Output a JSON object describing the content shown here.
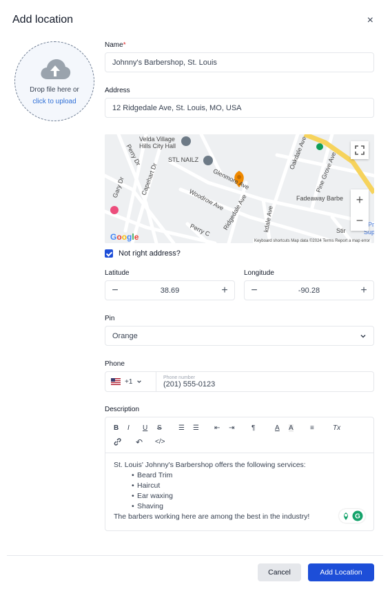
{
  "dialog": {
    "title": "Add location",
    "close": "×"
  },
  "upload": {
    "text": "Drop file here or",
    "link": "click to upload"
  },
  "name": {
    "label": "Name",
    "required_mark": "*",
    "value": "Johnny's Barbershop, St. Louis"
  },
  "address": {
    "label": "Address",
    "value": "12 Ridgedale Ave, St. Louis, MO, USA"
  },
  "map": {
    "labels": {
      "poi1_line1": "Velda Village",
      "poi1_line2": "Hills City Hall",
      "stl_nailz": "STL NAILZ",
      "glenmore": "Glenmore Ave",
      "woodrow": "Woodrow Ave",
      "ridgedale": "Ridgedale Ave",
      "oakdale": "Oakdale Ave",
      "pine_grove": "Pine Grove Ave",
      "fadeaway": "Fadeaway Barbe",
      "capehart": "Capehart Dr",
      "gary": "Gary Dr",
      "perry_dr": "Perry Dr",
      "perry_c": "Perry C",
      "kdale": "kdale Ave",
      "stir": "Stir",
      "pr": "Pr",
      "sup": "Sup"
    },
    "google": "Google",
    "footer": "Keyboard shortcuts   Map data ©2024   Terms   Report a map error",
    "zoom_in": "+",
    "zoom_out": "−"
  },
  "not_right_address": {
    "label": "Not right address?",
    "checked": true
  },
  "latitude": {
    "label": "Latitude",
    "value": "38.69",
    "minus": "−",
    "plus": "+"
  },
  "longitude": {
    "label": "Longitude",
    "value": "-90.28",
    "minus": "−",
    "plus": "+"
  },
  "pin": {
    "label": "Pin",
    "value": "Orange"
  },
  "phone": {
    "label": "Phone",
    "code": "+1",
    "placeholder": "Phone number",
    "value": "(201) 555-0123"
  },
  "description": {
    "label": "Description",
    "toolbar": {
      "bold": "B",
      "italic": "I",
      "underline": "U",
      "strike": "S",
      "ordered": "☰",
      "bullet": "☰",
      "outdent": "⇤",
      "indent": "⇥",
      "paragraph": "¶",
      "font_color": "A",
      "highlight": "A",
      "align": "≡",
      "clear": "Tx",
      "link": "🔗",
      "undo": "↶",
      "code": "</>"
    },
    "intro": "St. Louis' Johnny's Barbershop offers the following services:",
    "services": [
      "Beard Trim",
      "Haircut",
      "Ear waxing",
      "Shaving"
    ],
    "outro": "The barbers working here are among the best in the industry!"
  },
  "buttons": {
    "cancel": "Cancel",
    "add": "Add Location"
  },
  "colors": {
    "primary": "#1d4ed8",
    "pin": "#f08a00",
    "highway": "#f6d35c"
  }
}
